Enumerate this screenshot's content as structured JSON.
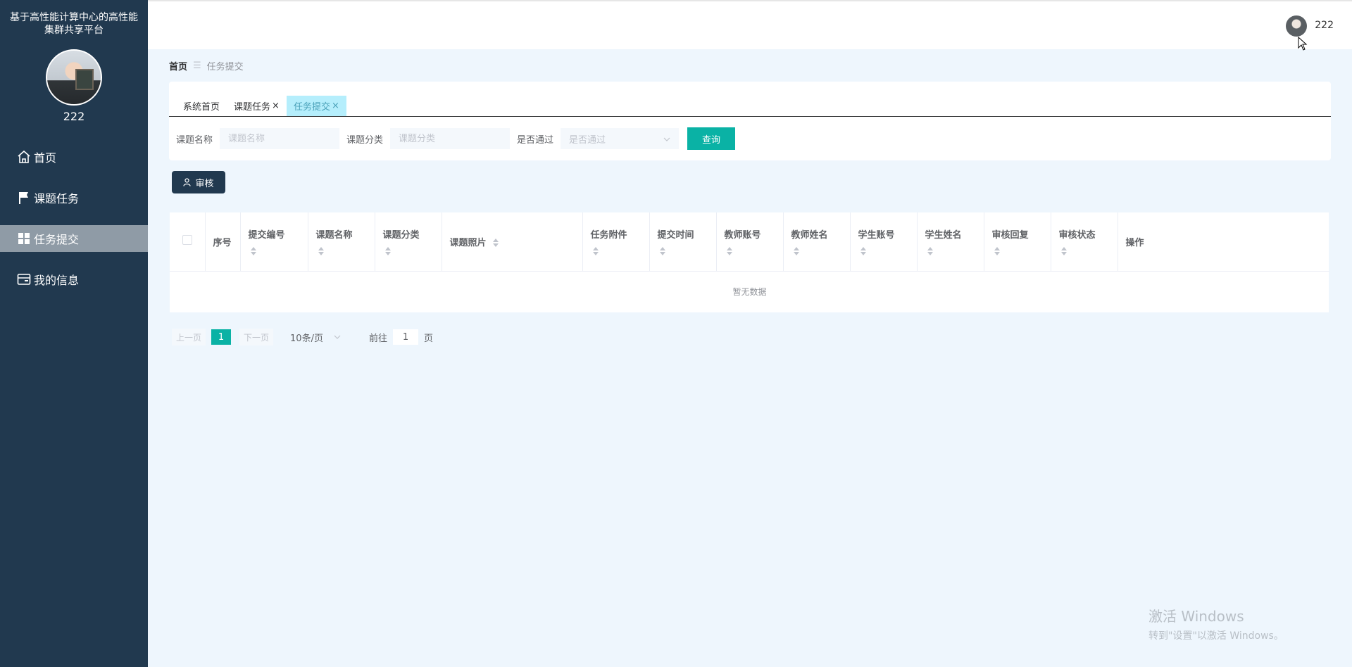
{
  "sidebar": {
    "app_title_line1": "基于高性能计算中心的高性能",
    "app_title_line2": "集群共享平台",
    "username": "222",
    "menu": [
      {
        "label": "首页",
        "icon": "home-icon"
      },
      {
        "label": "课题任务",
        "icon": "flag-icon"
      },
      {
        "label": "任务提交",
        "icon": "grid-icon",
        "active": true
      },
      {
        "label": "我的信息",
        "icon": "id-card-icon"
      }
    ]
  },
  "header": {
    "username": "222"
  },
  "breadcrumb": {
    "home": "首页",
    "separator": "☰",
    "current": "任务提交"
  },
  "tabs": [
    {
      "label": "系统首页",
      "closable": false
    },
    {
      "label": "课题任务",
      "closable": true
    },
    {
      "label": "任务提交",
      "closable": true,
      "active": true
    }
  ],
  "filters": {
    "name_label": "课题名称",
    "name_placeholder": "课题名称",
    "category_label": "课题分类",
    "category_placeholder": "课题分类",
    "pass_label": "是否通过",
    "pass_placeholder": "是否通过",
    "query_label": "查询"
  },
  "audit_button": "审核",
  "table": {
    "columns": [
      "序号",
      "提交编号",
      "课题名称",
      "课题分类",
      "课题照片",
      "任务附件",
      "提交时间",
      "教师账号",
      "教师姓名",
      "学生账号",
      "学生姓名",
      "审核回复",
      "审核状态",
      "操作"
    ],
    "empty_text": "暂无数据"
  },
  "pagination": {
    "prev": "上一页",
    "current_page": "1",
    "next": "下一页",
    "page_size": "10条/页",
    "goto_label": "前往",
    "goto_value": "1",
    "page_suffix": "页"
  },
  "watermark": {
    "line1": "激活 Windows",
    "line2": "转到\"设置\"以激活 Windows。"
  },
  "colors": {
    "sidebar_bg": "#21394f",
    "accent": "#0ab2a5",
    "active_tab": "#b5eefc",
    "page_bg": "#eef6fd"
  }
}
